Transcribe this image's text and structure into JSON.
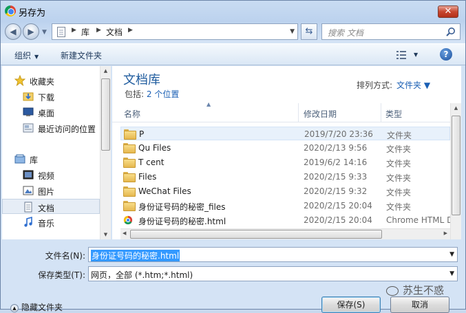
{
  "window": {
    "title": "另存为",
    "close_label": "✕"
  },
  "address": {
    "crumbs": [
      "库",
      "文档"
    ],
    "search_placeholder": "搜索 文档"
  },
  "toolbar": {
    "organize_label": "组织",
    "new_folder_label": "新建文件夹",
    "help_label": "?"
  },
  "sidebar": {
    "items": [
      {
        "label": "收藏夹",
        "icon": "star-icon"
      },
      {
        "label": "下载",
        "icon": "download-folder-icon"
      },
      {
        "label": "桌面",
        "icon": "desktop-icon"
      },
      {
        "label": "最近访问的位置",
        "icon": "recent-places-icon"
      },
      {
        "label": "库",
        "icon": "library-icon"
      },
      {
        "label": "视频",
        "icon": "video-icon"
      },
      {
        "label": "图片",
        "icon": "picture-icon"
      },
      {
        "label": "文档",
        "icon": "document-icon"
      },
      {
        "label": "音乐",
        "icon": "music-icon"
      }
    ]
  },
  "library": {
    "title": "文档库",
    "includes_label": "包括:",
    "includes_link": "2 个位置",
    "arrange_label": "排列方式:",
    "arrange_value": "文件夹"
  },
  "columns": {
    "name": "名称",
    "modified": "修改日期",
    "type": "类型"
  },
  "files": [
    {
      "name": "P",
      "date": "2019/7/20 23:36",
      "type": "文件夹",
      "icon": "folder-icon"
    },
    {
      "name": "Qu     Files",
      "date": "2020/2/13 9:56",
      "type": "文件夹",
      "icon": "folder-icon"
    },
    {
      "name": "T      cent",
      "date": "2019/6/2 14:16",
      "type": "文件夹",
      "icon": "folder-icon"
    },
    {
      "name": "        Files",
      "date": "2020/2/15 9:33",
      "type": "文件夹",
      "icon": "folder-icon"
    },
    {
      "name": "WeChat Files",
      "date": "2020/2/15 9:32",
      "type": "文件夹",
      "icon": "folder-icon"
    },
    {
      "name": "身份证号码的秘密_files",
      "date": "2020/2/15 20:04",
      "type": "文件夹",
      "icon": "folder-icon"
    },
    {
      "name": "身份证号码的秘密.html",
      "date": "2020/2/15 20:04",
      "type": "Chrome HTML D",
      "icon": "chrome-icon"
    }
  ],
  "form": {
    "filename_label": "文件名(N):",
    "filename_value": "身份证号码的秘密.html",
    "filetype_label": "保存类型(T):",
    "filetype_value": "网页，全部 (*.htm;*.html)"
  },
  "footer": {
    "hide_folders_label": "隐藏文件夹",
    "save_label": "保存(S)",
    "cancel_label": "取消",
    "watermark": "苏生不惑"
  }
}
